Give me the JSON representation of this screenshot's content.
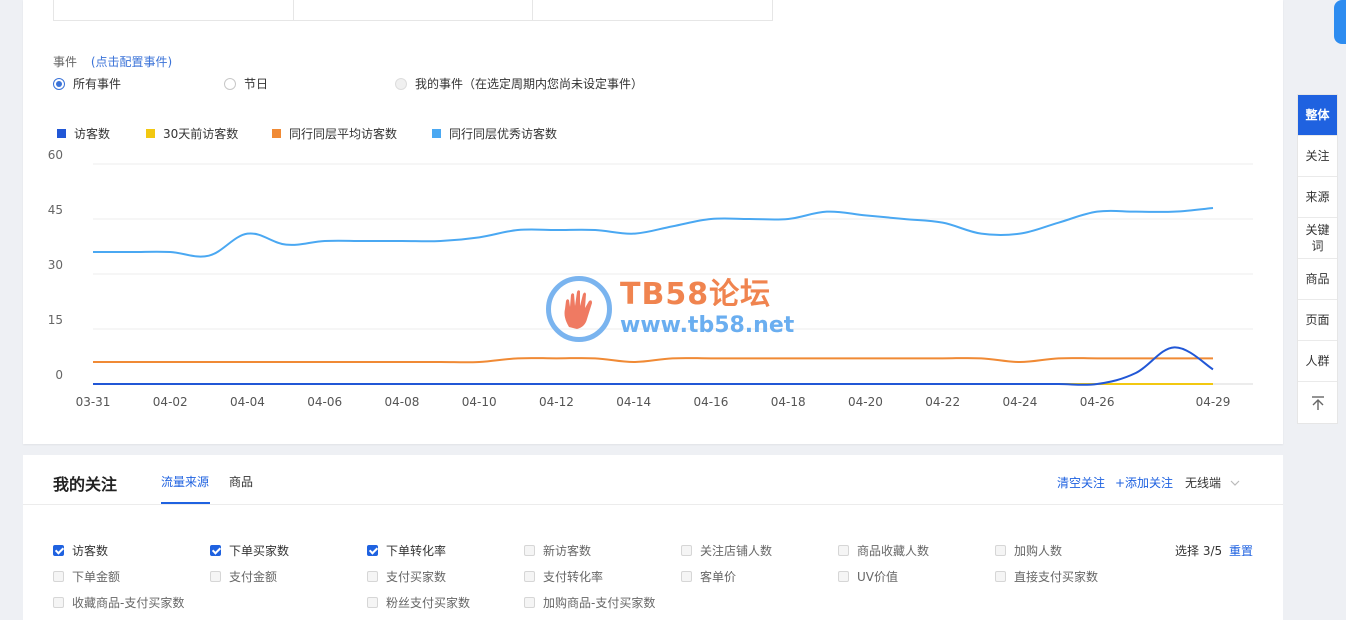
{
  "events": {
    "title": "事件",
    "config_link": "(点击配置事件)",
    "options": [
      {
        "label": "所有事件",
        "selected": true,
        "disabled": false
      },
      {
        "label": "节日",
        "selected": false,
        "disabled": false
      },
      {
        "label": "我的事件（在选定周期内您尚未设定事件）",
        "selected": false,
        "disabled": true
      }
    ]
  },
  "watermark": {
    "title": "TB58论坛",
    "url": "www.tb58.net"
  },
  "chart_data": {
    "type": "line",
    "categories": [
      "03-31",
      "04-01",
      "04-02",
      "04-03",
      "04-04",
      "04-05",
      "04-06",
      "04-07",
      "04-08",
      "04-09",
      "04-10",
      "04-11",
      "04-12",
      "04-13",
      "04-14",
      "04-15",
      "04-16",
      "04-17",
      "04-18",
      "04-19",
      "04-20",
      "04-21",
      "04-22",
      "04-23",
      "04-24",
      "04-25",
      "04-26",
      "04-27",
      "04-28",
      "04-29"
    ],
    "x_tick_labels": [
      "03-31",
      "04-02",
      "04-04",
      "04-06",
      "04-08",
      "04-10",
      "04-12",
      "04-14",
      "04-16",
      "04-18",
      "04-20",
      "04-22",
      "04-24",
      "04-26",
      "04-29"
    ],
    "y_ticks": [
      "60",
      "45",
      "30",
      "15",
      "0"
    ],
    "ylim": [
      0,
      60
    ],
    "grid": true,
    "legend_position": "top-left",
    "series": [
      {
        "name": "访客数",
        "color": "#2157d6",
        "values": [
          0,
          0,
          0,
          0,
          0,
          0,
          0,
          0,
          0,
          0,
          0,
          0,
          0,
          0,
          0,
          0,
          0,
          0,
          0,
          0,
          0,
          0,
          0,
          0,
          0,
          0,
          0,
          3,
          10,
          4
        ]
      },
      {
        "name": "30天前访客数",
        "color": "#f2c811",
        "values": [
          0,
          0,
          0,
          0,
          0,
          0,
          0,
          0,
          0,
          0,
          0,
          0,
          0,
          0,
          0,
          0,
          0,
          0,
          0,
          0,
          0,
          0,
          0,
          0,
          0,
          0,
          0,
          0,
          0,
          0
        ]
      },
      {
        "name": "同行同层平均访客数",
        "color": "#f08a35",
        "values": [
          6,
          6,
          6,
          6,
          6,
          6,
          6,
          6,
          6,
          6,
          6,
          7,
          7,
          7,
          6,
          7,
          7,
          7,
          7,
          7,
          7,
          7,
          7,
          7,
          6,
          7,
          7,
          7,
          7,
          7
        ]
      },
      {
        "name": "同行同层优秀访客数",
        "color": "#4aa8f2",
        "values": [
          36,
          36,
          36,
          35,
          41,
          38,
          39,
          39,
          39,
          39,
          40,
          42,
          42,
          42,
          41,
          43,
          45,
          45,
          45,
          47,
          46,
          45,
          44,
          41,
          41,
          44,
          47,
          47,
          47,
          48
        ]
      }
    ]
  },
  "sidebar": {
    "items": [
      "整体",
      "关注",
      "来源",
      "关键词",
      "商品",
      "页面",
      "人群"
    ],
    "top_icon": "back-to-top-icon"
  },
  "my_follow": {
    "title": "我的关注",
    "tabs": [
      "流量来源",
      "商品"
    ],
    "clear_label": "清空关注",
    "add_label": "+添加关注",
    "device_label": "无线端",
    "selection": "选择 3/5",
    "reset_label": "重置",
    "metrics": [
      {
        "label": "访客数",
        "checked": true
      },
      {
        "label": "下单买家数",
        "checked": true
      },
      {
        "label": "下单转化率",
        "checked": true
      },
      {
        "label": "新访客数",
        "checked": false
      },
      {
        "label": "关注店铺人数",
        "checked": false
      },
      {
        "label": "商品收藏人数",
        "checked": false
      },
      {
        "label": "加购人数",
        "checked": false
      },
      {
        "label": "下单金额",
        "checked": false
      },
      {
        "label": "支付金额",
        "checked": false
      },
      {
        "label": "支付买家数",
        "checked": false
      },
      {
        "label": "支付转化率",
        "checked": false
      },
      {
        "label": "客单价",
        "checked": false
      },
      {
        "label": "UV价值",
        "checked": false
      },
      {
        "label": "直接支付买家数",
        "checked": false
      },
      {
        "label": "收藏商品-支付买家数",
        "checked": false
      },
      {
        "label": "粉丝支付买家数",
        "checked": false
      },
      {
        "label": "加购商品-支付买家数",
        "checked": false
      }
    ]
  }
}
